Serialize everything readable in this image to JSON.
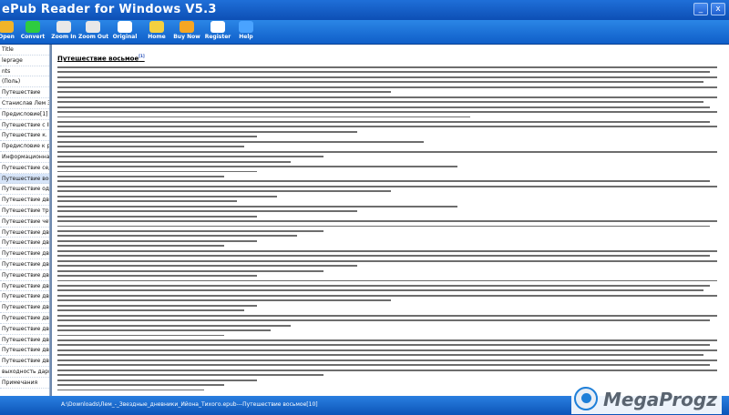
{
  "window": {
    "title": "ePub Reader for Windows V5.3"
  },
  "toolbar": {
    "buttons": [
      {
        "label": "Open",
        "icon": "folder-open-icon",
        "color": "#f0b429"
      },
      {
        "label": "Convert",
        "icon": "convert-arrow-icon",
        "color": "#2ecc40"
      },
      {
        "label": "Zoom In",
        "icon": "zoom-in-icon",
        "color": "#e8e8e8"
      },
      {
        "label": "Zoom Out",
        "icon": "zoom-out-icon",
        "color": "#e8e8e8"
      },
      {
        "label": "Original",
        "icon": "original-size-icon",
        "color": "#ffffff"
      },
      {
        "label": "Home",
        "icon": "home-icon",
        "color": "#f4d03f"
      },
      {
        "label": "Buy Now",
        "icon": "cart-icon",
        "color": "#f5a623"
      },
      {
        "label": "Register",
        "icon": "register-key-icon",
        "color": "#ffffff"
      },
      {
        "label": "Help",
        "icon": "help-icon",
        "color": "#4aa3ff"
      }
    ]
  },
  "sidebar": {
    "items": [
      "Title",
      "leprage",
      "nts",
      "(Поль)",
      "Путешествие",
      "Станислав Лем Звезд",
      "Предисловие[1]",
      "Путешествие с III 1о)",
      "Путешествие к. росл",
      "Предисловие к расс",
      "Информационная за",
      "Путешествие седьм",
      "Путешествие восьм",
      "Путешествие одинн",
      "Путешествие двена",
      "Путешествие трина",
      "Путешествие четыр",
      "Путешествие двадц",
      "Путешествие двадц",
      "Путешествие двадц",
      "Путешествие двадц",
      "Путешествие двадц",
      "Путешествие двадц",
      "Путешествие двадц",
      "Путешествие двадц",
      "Путешествие двадц",
      "Путешествие двадц",
      "Путешествие двадц",
      "Путешествие двадц",
      "Путешествие двадц",
      "выходность дарим",
      "Примечания"
    ],
    "active_index": 12
  },
  "content": {
    "chapter_title": "Путешествие восьмое",
    "footnote_marker": "[1]"
  },
  "status": {
    "path": "A:\\Downloads\\Лем_-_Звездные_дневники_Ийона_Тихого.epub---Путешествие восьмое[10]"
  },
  "watermark": {
    "text": "MegaProgz"
  }
}
